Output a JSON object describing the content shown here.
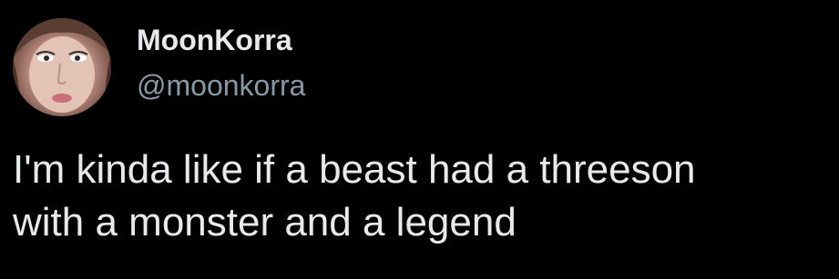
{
  "colors": {
    "background": "#000000",
    "primary_text": "#e7e9ea",
    "secondary_text": "#8b98a5"
  },
  "author": {
    "display_name": "MoonKorra",
    "handle": "@moonkorra",
    "avatar_icon": "profile-photo"
  },
  "tweet": {
    "lines": [
      "I'm kinda like if a beast had a threeson",
      "with a monster and a legend"
    ]
  }
}
